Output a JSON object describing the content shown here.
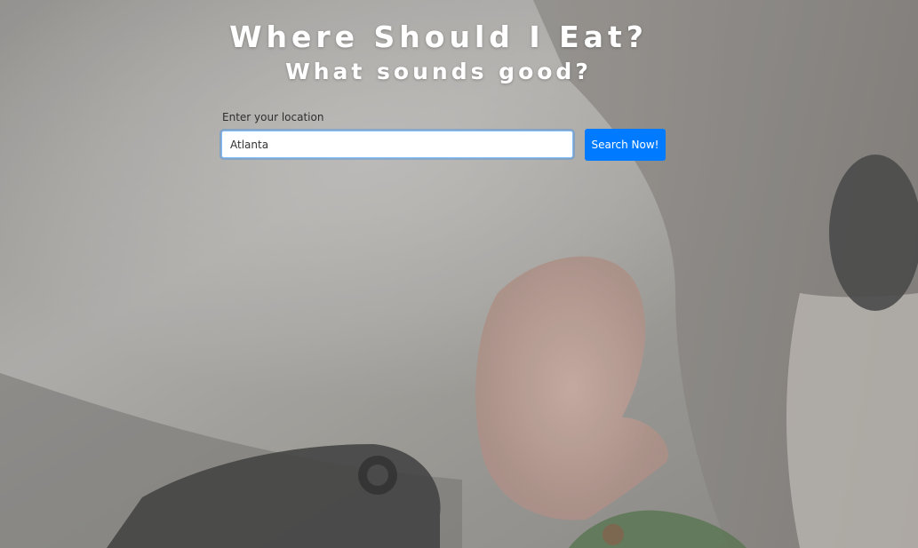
{
  "hero": {
    "title": "Where Should I Eat?",
    "subtitle": "What sounds good?"
  },
  "search": {
    "label": "Enter your location",
    "value": "Atlanta",
    "button_label": "Search Now!"
  },
  "colors": {
    "button": "#007bff",
    "input_focus": "#80bdff",
    "heading": "#ffffff"
  }
}
